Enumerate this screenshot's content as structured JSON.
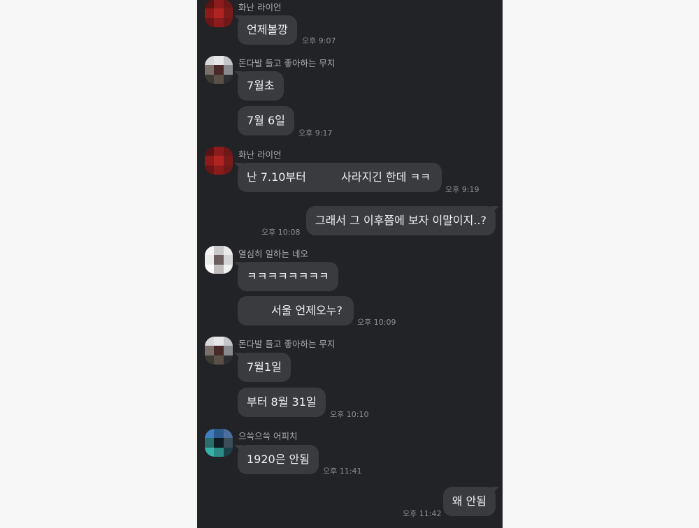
{
  "messages": [
    {
      "sender": "화난 라이언",
      "text": "언제볼깡",
      "time": "오후 9:07"
    },
    {
      "sender": "돈다발 들고 좋아하는 무지",
      "text": "7월초",
      "time": ""
    },
    {
      "sender": "",
      "text": "7월 6일",
      "time": "오후 9:17"
    },
    {
      "sender": "화난 라이언",
      "text_part1": "난 7.10부터",
      "text_part2": "사라지긴 한데 ㅋㅋ",
      "time": "오후 9:19"
    },
    {
      "sender": "me",
      "text": "그래서 그 이후쯤에 보자 이말이지..?",
      "time": "오후 10:08"
    },
    {
      "sender": "열심히 일하는 네오",
      "text": "ㅋㅋㅋㅋㅋㅋㅋㅋ",
      "time": ""
    },
    {
      "sender": "",
      "text": "서울 언제오누?",
      "time": "오후 10:09"
    },
    {
      "sender": "돈다발 들고 좋아하는 무지",
      "text": "7월1일",
      "time": ""
    },
    {
      "sender": "",
      "text": "부터 8월 31일",
      "time": "오후 10:10"
    },
    {
      "sender": "으쓱으쓱 어피치",
      "text": "1920은 안됨",
      "time": "오후 11:41"
    },
    {
      "sender": "me",
      "text": "왜 안됨",
      "time": "오후 11:42"
    }
  ],
  "colors": {
    "page_background": "#f7f7f7",
    "chat_background": "#222327",
    "bubble": "#3a3b3f",
    "bubble_text": "#f0f0f2",
    "name_text": "#a9abb0",
    "time_text": "#8d8f94"
  },
  "avatars": {
    "ryan": [
      "#5a1414",
      "#8c1c1c",
      "#6e1818",
      "#8e1a1a",
      "#b02424",
      "#7a1a1a",
      "#6a1616",
      "#8a1c1c",
      "#701818"
    ],
    "muzi": [
      "#d9d9dc",
      "#e6e6e8",
      "#c6c6c9",
      "#7b6f6a",
      "#4a2a28",
      "#8a8b8e",
      "#3a3c33",
      "#5a5048",
      "#2e2e30"
    ],
    "neo": [
      "#f4f4f4",
      "#c9c9cb",
      "#e9e9ea",
      "#eaeaea",
      "#6b5e5c",
      "#d4d4d6",
      "#ffffff",
      "#c2bdbd",
      "#f0f0f0"
    ],
    "apeach": [
      "#3f7fc0",
      "#2c5a8a",
      "#4b6e9c",
      "#2a6d6a",
      "#0f1c22",
      "#3a4e58",
      "#38b2a8",
      "#2a8c85",
      "#1c4048"
    ]
  }
}
